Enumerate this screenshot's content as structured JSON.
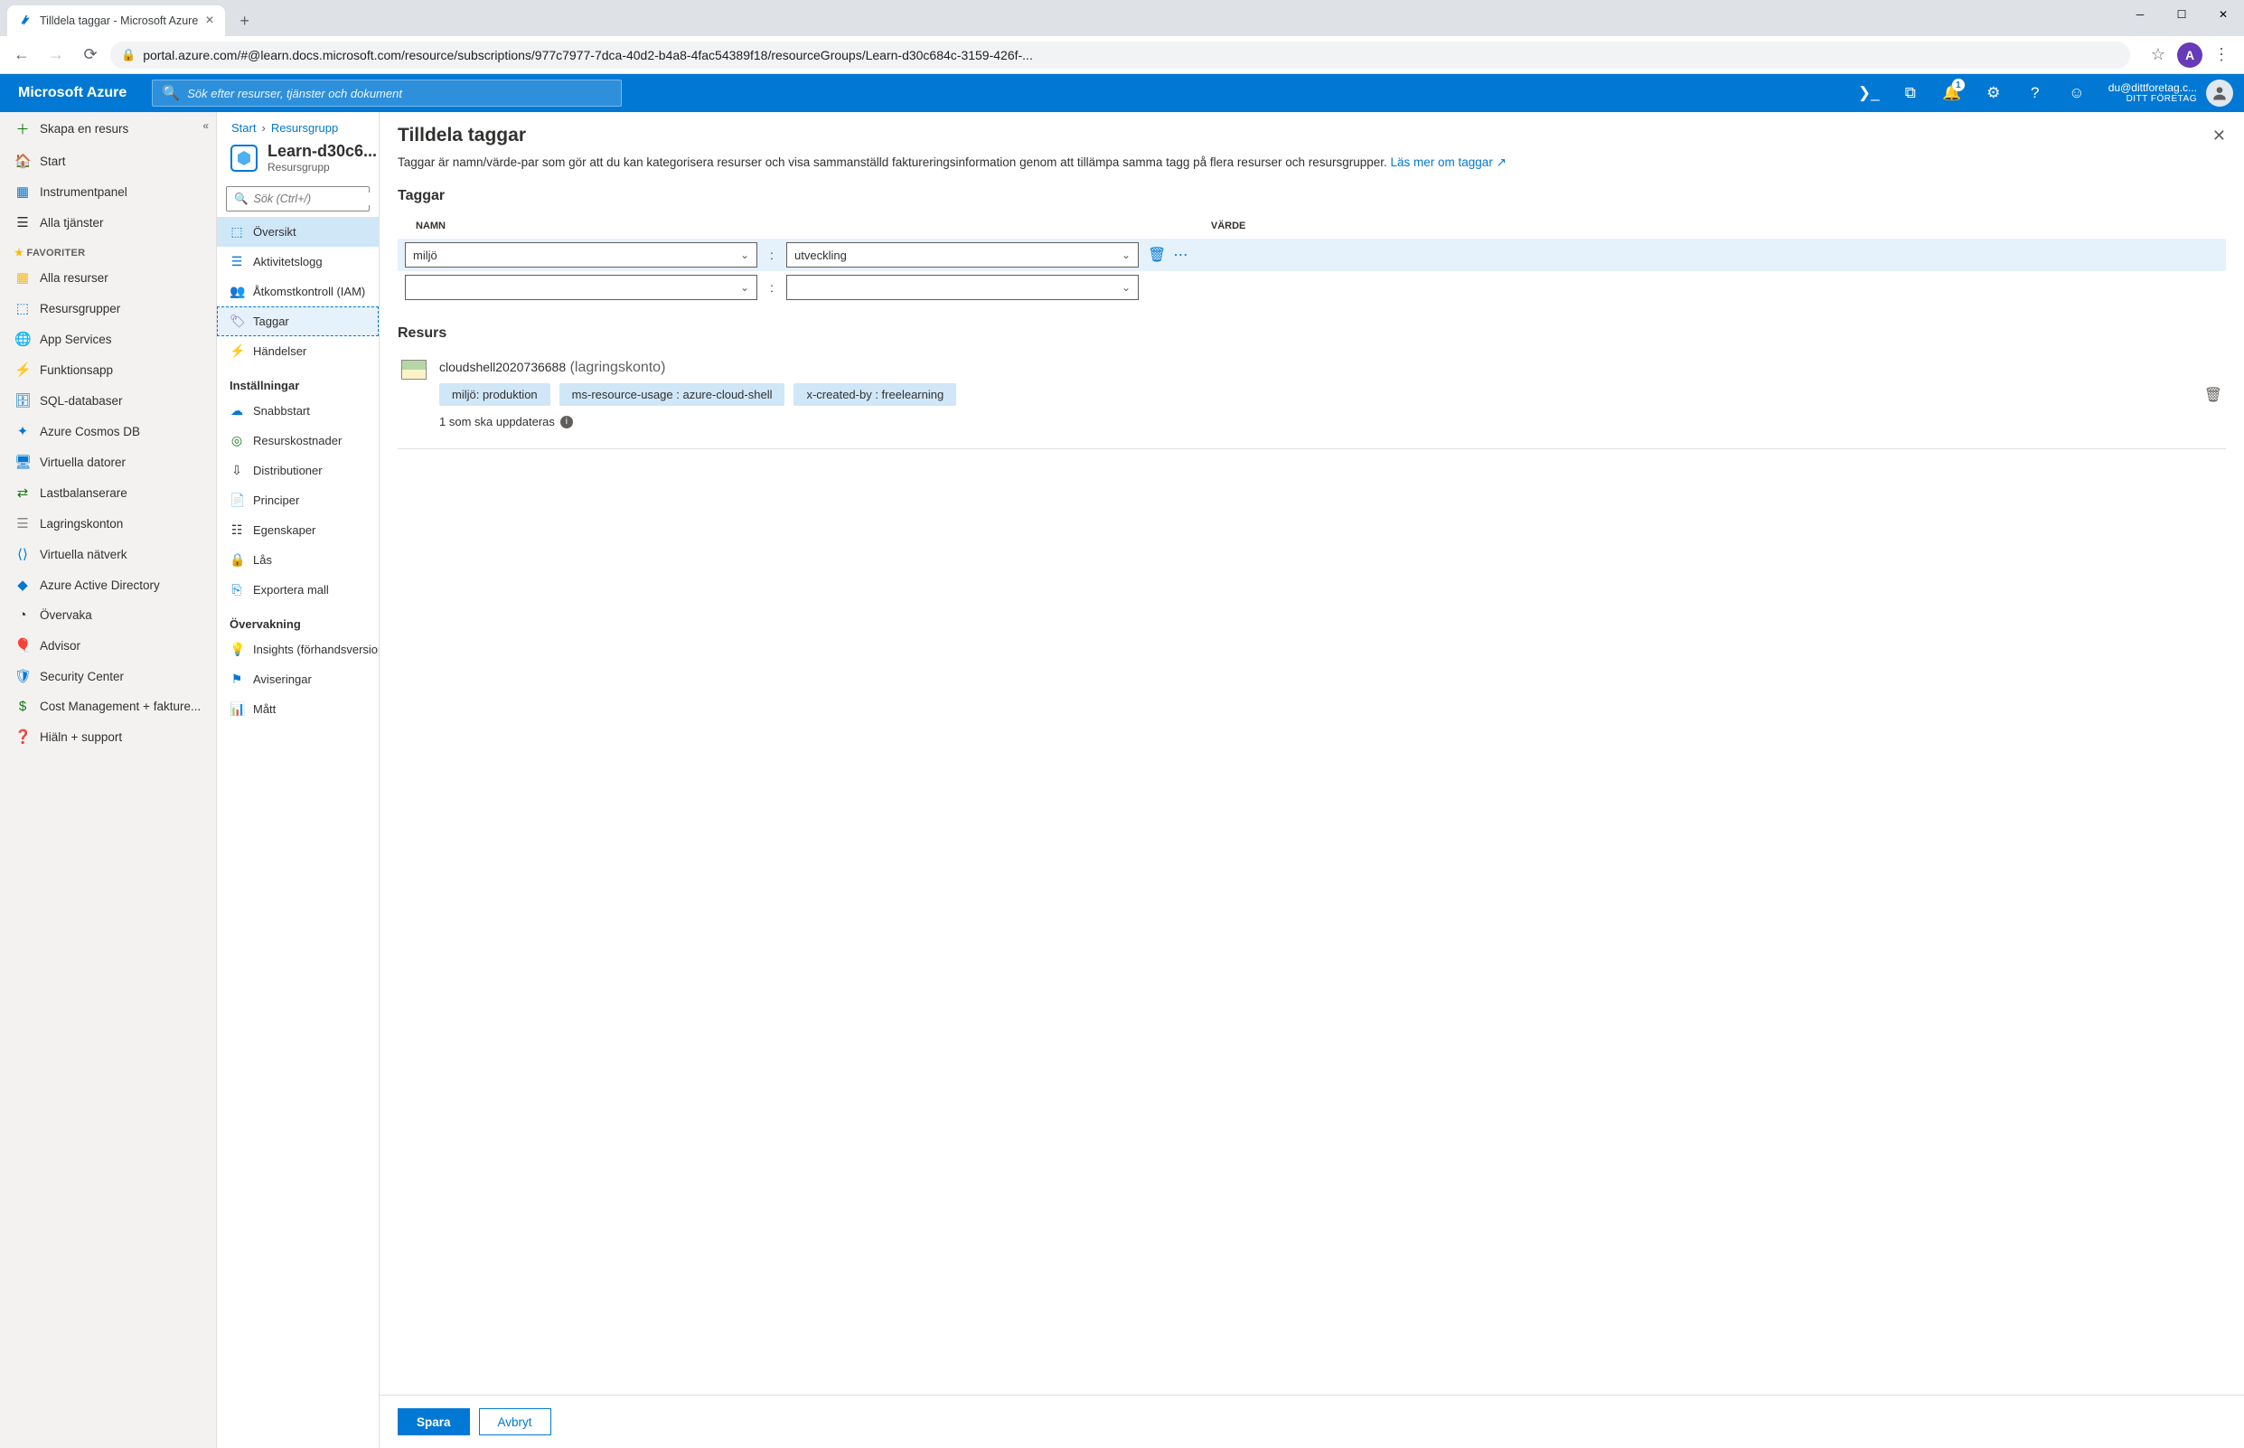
{
  "browser": {
    "tab_title": "Tilldela taggar - Microsoft Azure",
    "url": "portal.azure.com/#@learn.docs.microsoft.com/resource/subscriptions/977c7977-7dca-40d2-b4a8-4fac54389f18/resourceGroups/Learn-d30c684c-3159-426f-...",
    "profile_letter": "A"
  },
  "azure_top": {
    "brand": "Microsoft Azure",
    "search_placeholder": "Sök efter resurser, tjänster och dokument",
    "notif_count": "1",
    "account_email": "du@dittforetag.c...",
    "account_tenant": "DITT FÖRETAG"
  },
  "far_left": {
    "create": "Skapa en resurs",
    "home": "Start",
    "dashboard": "Instrumentpanel",
    "all_services": "Alla tjänster",
    "favorites_label": "FAVORITER",
    "items": [
      "Alla resurser",
      "Resursgrupper",
      "App Services",
      "Funktionsapp",
      "SQL-databaser",
      "Azure Cosmos DB",
      "Virtuella datorer",
      "Lastbalanserare",
      "Lagringskonton",
      "Virtuella nätverk",
      "Azure Active Directory",
      "Övervaka",
      "Advisor",
      "Security Center",
      "Cost Management + fakture...",
      "Hiäln + support"
    ]
  },
  "breadcrumb": {
    "start": "Start",
    "rg": "Resursgrupp"
  },
  "rg": {
    "name": "Learn-d30c6...",
    "type": "Resursgrupp",
    "search_placeholder": "Sök (Ctrl+/)"
  },
  "mid": {
    "items1": [
      "Översikt",
      "Aktivitetslogg",
      "Åtkomstkontroll (IAM)",
      "Taggar",
      "Händelser"
    ],
    "section_settings": "Inställningar",
    "items2": [
      "Snabbstart",
      "Resurskostnader",
      "Distributioner",
      "Principer",
      "Egenskaper",
      "Lås",
      "Exportera mall"
    ],
    "section_monitor": "Övervakning",
    "items3": [
      "Insights (förhandsversion)",
      "Aviseringar",
      "Mått"
    ]
  },
  "blade": {
    "title": "Tilldela taggar",
    "desc1": "Taggar är namn/värde-par som gör att du kan kategorisera resurser och visa sammanställd faktureringsinformation genom att tillämpa samma tagg på flera resurser och resursgrupper. ",
    "learn_more": "Läs mer om taggar",
    "tags_heading": "Taggar",
    "col_name": "NAMN",
    "col_value": "VÄRDE",
    "tag1_name": "miljö",
    "tag1_value": "utveckling",
    "resource_heading": "Resurs",
    "res_name": "cloudshell2020736688",
    "res_type": "(lagringskonto)",
    "chips": [
      "miljö: produktion",
      "ms-resource-usage : azure-cloud-shell",
      "x-created-by : freelearning"
    ],
    "update_text": "1 som ska uppdateras",
    "save": "Spara",
    "cancel": "Avbryt"
  }
}
